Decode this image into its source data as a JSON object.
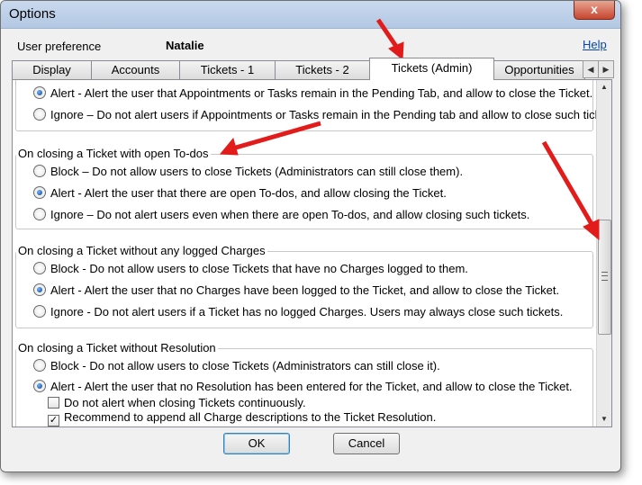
{
  "window": {
    "title": "Options",
    "close_glyph": "x"
  },
  "header": {
    "pref_label": "User preference",
    "user": "Natalie",
    "help": "Help"
  },
  "tabs": [
    {
      "label": "Display"
    },
    {
      "label": "Accounts"
    },
    {
      "label": "Tickets - 1"
    },
    {
      "label": "Tickets - 2"
    },
    {
      "label": "Tickets (Admin)"
    },
    {
      "label": "Opportunities"
    }
  ],
  "tab_scroll": {
    "left": "◀",
    "right": "▶"
  },
  "scrollbar": {
    "up": "▲",
    "down": "▼"
  },
  "sections": [
    {
      "options": [
        {
          "label": "Alert - Alert the user that Appointments or Tasks remain in the Pending Tab, and allow to close the Ticket.",
          "selected": true
        },
        {
          "label": "Ignore – Do not alert users if Appointments or Tasks remain in the Pending tab and allow to close such tickets.",
          "selected": false
        }
      ]
    },
    {
      "title": "On closing a Ticket with open To-dos",
      "options": [
        {
          "label": "Block – Do not allow users to close Tickets (Administrators can still close them).",
          "selected": false
        },
        {
          "label": "Alert - Alert the user that there are open To-dos, and allow closing the Ticket.",
          "selected": true
        },
        {
          "label": "Ignore – Do not alert users even when there are open To-dos, and allow closing such tickets.",
          "selected": false
        }
      ]
    },
    {
      "title": "On closing a Ticket without any logged Charges",
      "options": [
        {
          "label": "Block - Do not allow users to close Tickets that have no Charges logged to them.",
          "selected": false
        },
        {
          "label": "Alert - Alert the user that no Charges have been logged to the Ticket, and allow to close the Ticket.",
          "selected": true
        },
        {
          "label": "Ignore - Do not alert users if a Ticket has no logged Charges. Users may always close such tickets.",
          "selected": false
        }
      ]
    },
    {
      "title": "On closing a Ticket without Resolution",
      "options": [
        {
          "label": "Block - Do not allow users to close Tickets (Administrators can still close it).",
          "selected": false
        },
        {
          "label": "Alert - Alert the user that no Resolution has been entered for the Ticket, and allow to close the Ticket.",
          "selected": true
        }
      ],
      "checkboxes": [
        {
          "label": "Do not alert when closing Tickets continuously.",
          "checked": false
        },
        {
          "label": "Recommend to append all Charge descriptions to the Ticket Resolution.",
          "checked": true
        }
      ]
    }
  ],
  "buttons": {
    "ok": "OK",
    "cancel": "Cancel"
  },
  "colors": {
    "annotation_arrow": "#e21b1b",
    "link": "#0645ad"
  }
}
